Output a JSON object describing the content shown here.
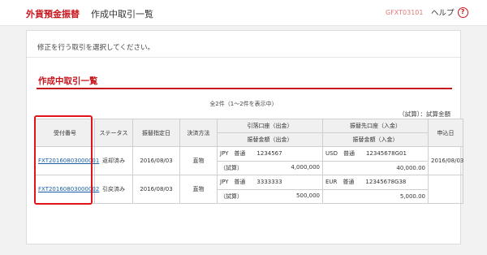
{
  "header": {
    "app_title": "外貨預金振替",
    "page_title": "作成中取引一覧",
    "screen_id": "GFXT03101",
    "help_label": "ヘルプ",
    "help_icon_glyph": "?"
  },
  "instruction": "修正を行う取引を選択してください。",
  "section_title": "作成中取引一覧",
  "count_text": "全2件（1～2件を表示中）",
  "trial_note": "（試算）：試算金額",
  "table": {
    "headers": {
      "receipt_no": "受付番号",
      "status": "ステータス",
      "transfer_date": "振替指定日",
      "settlement": "決済方法",
      "debit_account": "引落口座（出金）",
      "debit_amount": "振替金額（出金）",
      "credit_account": "振替先口座（入金）",
      "credit_amount": "振替金額（入金）",
      "applied_date": "申込日"
    },
    "rows": [
      {
        "receipt_no": "FXT20160803000001",
        "status": "返却済み",
        "transfer_date": "2016/08/03",
        "settlement": "直物",
        "debit_account": "JPY　普通　　1234567",
        "debit_label": "（試算）",
        "debit_amount": "4,000,000",
        "credit_account": "USD　普通　　12345678G01",
        "credit_amount": "40,000.00",
        "applied_date": "2016/08/03"
      },
      {
        "receipt_no": "FXT20160803000002",
        "status": "引戻済み",
        "transfer_date": "2016/08/03",
        "settlement": "直物",
        "debit_account": "JPY　普通　　3333333",
        "debit_label": "（試算）",
        "debit_amount": "500,000",
        "credit_account": "EUR　普通　　12345678G38",
        "credit_amount": "5,000.00",
        "applied_date": ""
      }
    ]
  },
  "colors": {
    "accent": "#c8161d",
    "highlight": "#e0131b",
    "link": "#1a5fa6"
  }
}
